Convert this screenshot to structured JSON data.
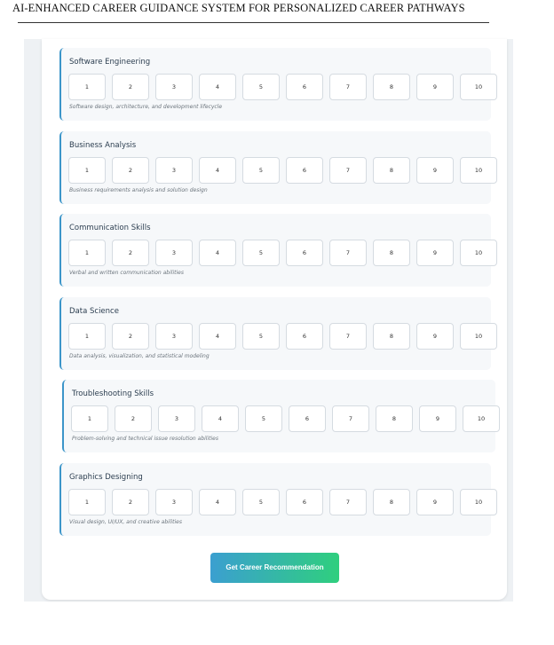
{
  "header": {
    "title": "AI-ENHANCED CAREER GUIDANCE SYSTEM FOR PERSONALIZED CAREER PATHWAYS"
  },
  "skills": [
    {
      "title": "Software Engineering",
      "description": "Software design, architecture, and development lifecycle"
    },
    {
      "title": "Business Analysis",
      "description": "Business requirements analysis and solution design"
    },
    {
      "title": "Communication Skills",
      "description": "Verbal and written communication abilities"
    },
    {
      "title": "Data Science",
      "description": "Data analysis, visualization, and statistical modeling"
    },
    {
      "title": "Troubleshooting Skills",
      "description": "Problem-solving and technical issue resolution abilities"
    },
    {
      "title": "Graphics Designing",
      "description": "Visual design, UI/UX, and creative abilities"
    }
  ],
  "rating_labels": [
    "1",
    "2",
    "3",
    "4",
    "5",
    "6",
    "7",
    "8",
    "9",
    "10"
  ],
  "submit_button": {
    "label": "Get Career Recommendation"
  }
}
